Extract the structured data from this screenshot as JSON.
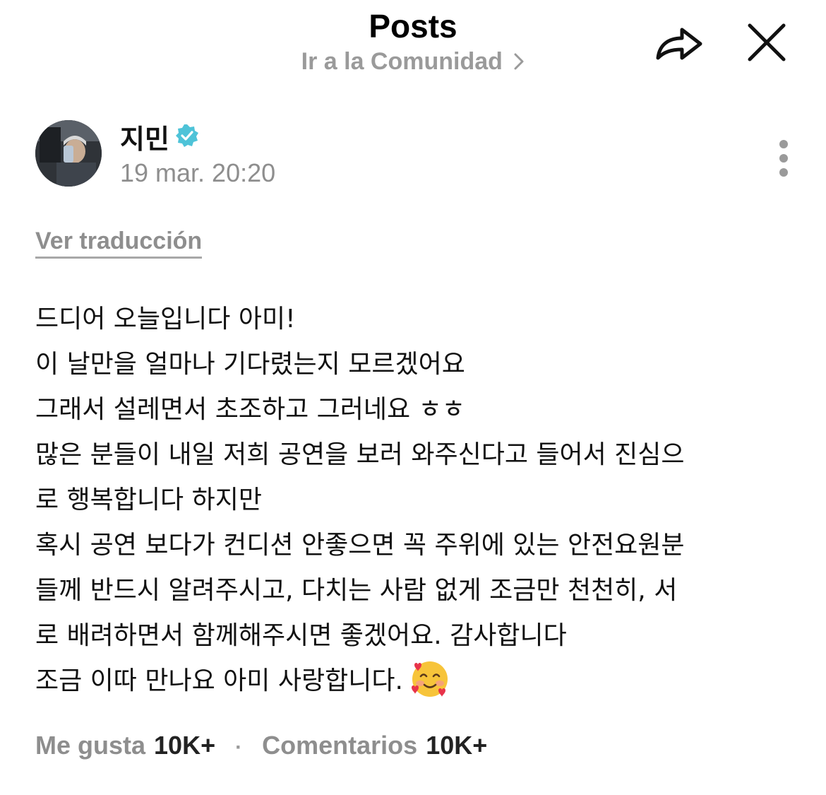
{
  "header": {
    "title": "Posts",
    "community_link": "Ir a la Comunidad"
  },
  "post": {
    "author": "지민",
    "verified": true,
    "date": "19 mar. 20:20",
    "translate_link": "Ver traducción",
    "lines": [
      "드디어 오늘입니다 아미!",
      "이 날만을 얼마나 기다렸는지 모르겠어요",
      "그래서 설레면서 초조하고 그러네요 ㅎㅎ",
      "많은 분들이 내일 저희 공연을 보러 와주신다고 들어서 진심으",
      "로 행복합니다 하지만",
      "혹시 공연 보다가 컨디션 안좋으면 꼭 주위에 있는 안전요원분",
      "들께 반드시 알려주시고, 다치는 사람 없게 조금만 천천히, 서",
      "로 배려하면서 함께해주시면 좋겠어요. 감사합니다",
      "조금 이따 만나요 아미 사랑합니다."
    ],
    "trailing_emoji": "smiling-face-with-hearts-icon"
  },
  "stats": {
    "likes_label": "Me gusta",
    "likes_count": "10K+",
    "comments_label": "Comentarios",
    "comments_count": "10K+"
  },
  "colors": {
    "muted": "#8e8e8e",
    "verified": "#4ec3d8",
    "text": "#111111"
  }
}
